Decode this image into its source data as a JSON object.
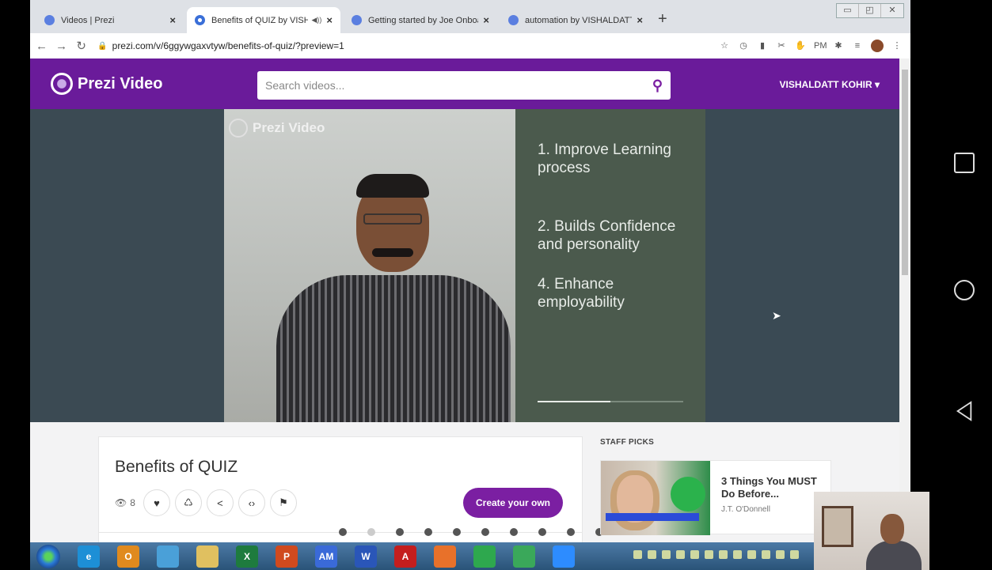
{
  "browser": {
    "tabs": [
      {
        "label": "Videos | Prezi",
        "close": "×",
        "active": false
      },
      {
        "label": "Benefits of QUIZ by VISHALD",
        "close": "×",
        "active": true
      },
      {
        "label": "Getting started by Joe Onboardi",
        "close": "×",
        "active": false
      },
      {
        "label": "automation by VISHALDATT KOH",
        "close": "×",
        "active": false
      }
    ],
    "new_tab": "+",
    "url": "prezi.com/v/6ggywgaxvtyw/benefits-of-quiz/?preview=1",
    "extension_pm": "PM"
  },
  "prezi": {
    "logo_text": "Prezi Video",
    "search_placeholder": "Search videos...",
    "user_menu": "VISHALDATT KOHIR ▾"
  },
  "video": {
    "watermark": "Prezi Video",
    "slide_items": [
      "1. Improve Learning process",
      "2. Builds Confidence and personality",
      "4. Enhance employability"
    ],
    "slide_progress": 0.5
  },
  "details": {
    "title": "Benefits of QUIZ",
    "views": "8",
    "create_button": "Create your own"
  },
  "staff_picks": {
    "heading": "STAFF PICKS",
    "item": {
      "title": "3 Things You MUST Do Before...",
      "author": "J.T. O'Donnell"
    }
  },
  "taskbar": {
    "apps": [
      {
        "name": "ie-icon",
        "label": "e",
        "color": "#1d8fd6"
      },
      {
        "name": "outlook-icon",
        "label": "O",
        "color": "#e08a1e"
      },
      {
        "name": "paint-icon",
        "label": "",
        "color": "#4aa0d8"
      },
      {
        "name": "explorer-icon",
        "label": "",
        "color": "#e0c060"
      },
      {
        "name": "excel-icon",
        "label": "X",
        "color": "#1e7b3e"
      },
      {
        "name": "powerpoint-icon",
        "label": "P",
        "color": "#d04a1e"
      },
      {
        "name": "am-icon",
        "label": "AM",
        "color": "#3a6ad8"
      },
      {
        "name": "word-icon",
        "label": "W",
        "color": "#2a56b8"
      },
      {
        "name": "acrobat-icon",
        "label": "A",
        "color": "#c41e1e"
      },
      {
        "name": "firefox-icon",
        "label": "",
        "color": "#e8712a"
      },
      {
        "name": "chrome-icon",
        "label": "",
        "color": "#2ea84e"
      },
      {
        "name": "android-icon",
        "label": "",
        "color": "#3aa85a"
      },
      {
        "name": "zoom-icon",
        "label": "",
        "color": "#2d8cff"
      }
    ]
  }
}
